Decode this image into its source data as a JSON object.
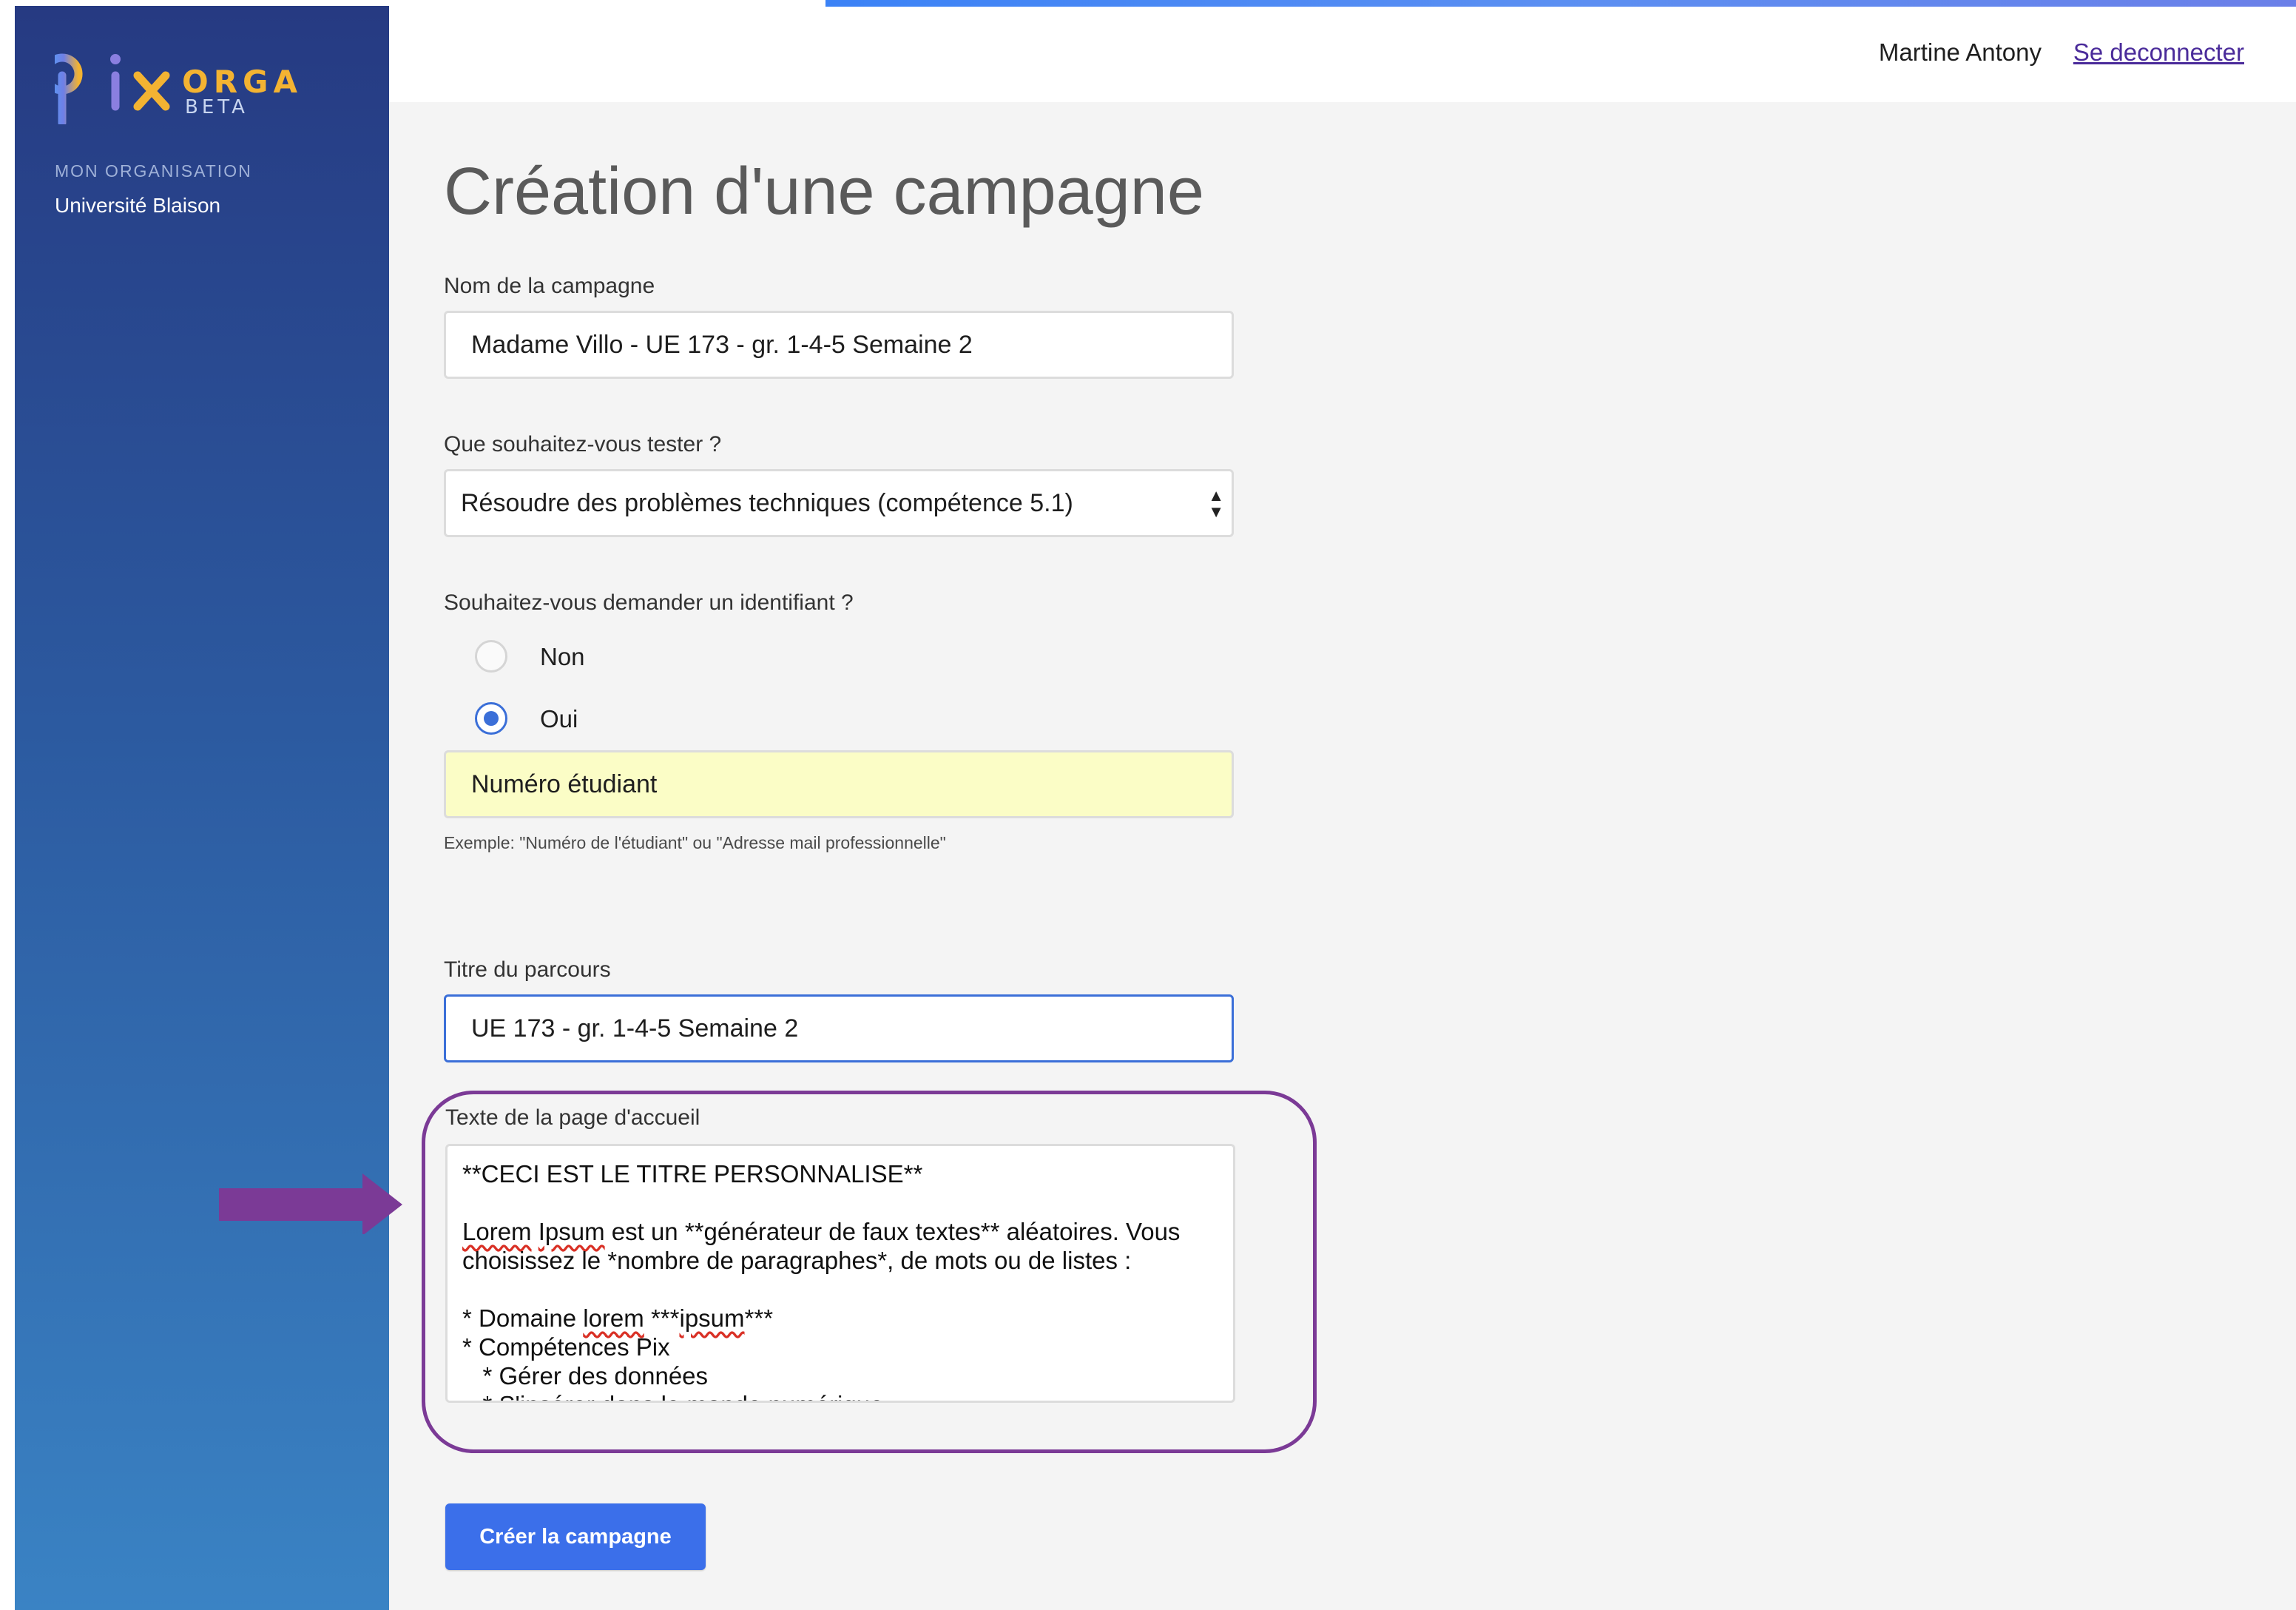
{
  "sidebar": {
    "logo": {
      "word": "pix",
      "product": "ORGA",
      "tag": "BETA"
    },
    "org_label": "MON ORGANISATION",
    "org_name": "Université Blaison"
  },
  "header": {
    "user_name": "Martine Antony",
    "logout_label": "Se deconnecter"
  },
  "form": {
    "title": "Création d'une campagne",
    "campaign_name": {
      "label": "Nom de la campagne",
      "value": "Madame Villo - UE 173 - gr. 1-4-5 Semaine 2"
    },
    "target": {
      "label": "Que souhaitez-vous tester ?",
      "value": "Résoudre des problèmes techniques (compétence 5.1)"
    },
    "identifier": {
      "label": "Souhaitez-vous demander un identifiant ?",
      "options": [
        {
          "label": "Non",
          "checked": false
        },
        {
          "label": "Oui",
          "checked": true
        }
      ],
      "value": "Numéro étudiant",
      "hint": "Exemple: \"Numéro de l'étudiant\" ou \"Adresse mail professionnelle\""
    },
    "course_title": {
      "label": "Titre du parcours",
      "value": "UE 173 - gr. 1-4-5 Semaine 2"
    },
    "home_text": {
      "label": "Texte de la page d'accueil",
      "line1": "**CECI EST LE TITRE PERSONNALISE**",
      "line2_a": "Lorem",
      "line2_b": "Ipsum",
      "line2_c": " est un **générateur de faux textes** aléatoires. Vous",
      "line3": "choisissez le *nombre de paragraphes*, de mots ou de listes :",
      "line4_a": "* Domaine ",
      "line4_b": "lorem",
      "line4_c": " ***",
      "line4_d": "ipsum",
      "line4_e": "***",
      "line5": "* Compétences Pix",
      "line6": "   * Gérer des données",
      "line7": "   * S'insérer dans le monde numérique"
    },
    "submit_label": "Créer la campagne"
  },
  "colors": {
    "accent": "#3b6fd8",
    "annotation": "#7b3a96",
    "sidebar_top": "#263a82",
    "sidebar_bottom": "#3a83c4",
    "logo_orga": "#f3b332"
  }
}
